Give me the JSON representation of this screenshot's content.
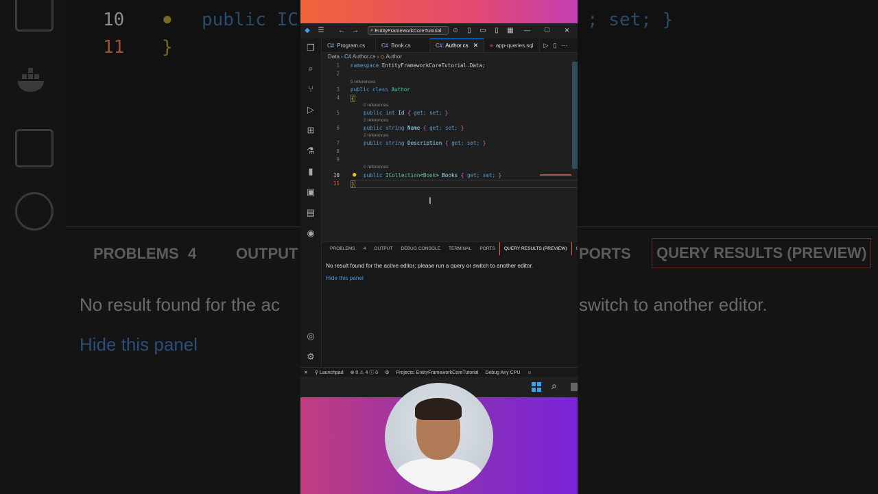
{
  "background": {
    "code_line_number_a": "10",
    "code_line_number_b": "11",
    "code_text": "public IC",
    "code_text_right": "; set; }",
    "panel_tabs": [
      "PROBLEMS",
      "4",
      "OUTPUT",
      "PORTS",
      "QUERY RESULTS (PREVIEW)"
    ],
    "message_left": "No result found for the ac",
    "message_right": "switch to another editor.",
    "link_text": "Hide this panel"
  },
  "titlebar": {
    "search_text": "EntityFrameworkCoreTutorial"
  },
  "tabs": [
    {
      "label": "Program.cs",
      "type": "cs",
      "active": false
    },
    {
      "label": "Book.cs",
      "type": "cs",
      "active": false
    },
    {
      "label": "Author.cs",
      "type": "cs",
      "active": true
    },
    {
      "label": "app-queries.sql",
      "type": "sql",
      "active": false
    }
  ],
  "breadcrumb": {
    "folder": "Data",
    "file": "Author.cs",
    "symbol": "Author"
  },
  "editor": {
    "lines": [
      {
        "n": "1",
        "lens": "",
        "html_id": "l1"
      },
      {
        "n": "2",
        "lens": "",
        "html_id": "l2"
      },
      {
        "n": "3",
        "lens": "5 references",
        "html_id": "l3"
      },
      {
        "n": "4",
        "lens": "",
        "html_id": "l4"
      },
      {
        "n": "5",
        "lens": "0 references",
        "html_id": "l5"
      },
      {
        "n": "6",
        "lens": "2 references",
        "html_id": "l6"
      },
      {
        "n": "7",
        "lens": "2 references",
        "html_id": "l7"
      },
      {
        "n": "8",
        "lens": "",
        "html_id": "l8"
      },
      {
        "n": "9",
        "lens": "",
        "html_id": "l9"
      },
      {
        "n": "10",
        "lens": "0 references",
        "html_id": "l10"
      },
      {
        "n": "11",
        "lens": "",
        "html_id": "l11"
      }
    ],
    "code": {
      "namespace_kw": "namespace",
      "namespace_name": "EntityFrameworkCoreTutorial.Data;",
      "public": "public",
      "class": "class",
      "class_name": "Author",
      "int": "int",
      "string": "string",
      "id": "Id",
      "name": "Name",
      "description": "Description",
      "icollection": "ICollection",
      "book": "Book",
      "books": "Books",
      "accessors": "get; set;"
    }
  },
  "panel": {
    "tabs": [
      "PROBLEMS",
      "4",
      "OUTPUT",
      "DEBUG CONSOLE",
      "TERMINAL",
      "PORTS",
      "QUERY RESULTS (PREVIEW)"
    ],
    "active_tab": "QUERY RESULTS (PREVIEW)",
    "message": "No result found for the active editor; please run a query or switch to another editor.",
    "link": "Hide this panel"
  },
  "statusbar": {
    "launchpad": "Launchpad",
    "errors": "0",
    "warnings": "4",
    "info": "0",
    "project": "Projects: EntityFrameworkCoreTutorial",
    "debug": "Debug Any CPU"
  },
  "colors": {
    "accent_top_left": "#f0643a",
    "accent_top_right": "#c33fb0",
    "accent_bottom_left": "#c23d7f",
    "accent_bottom_right": "#7a24d8",
    "editor_bg": "#1f1f1f",
    "link": "#3b9cf0"
  }
}
